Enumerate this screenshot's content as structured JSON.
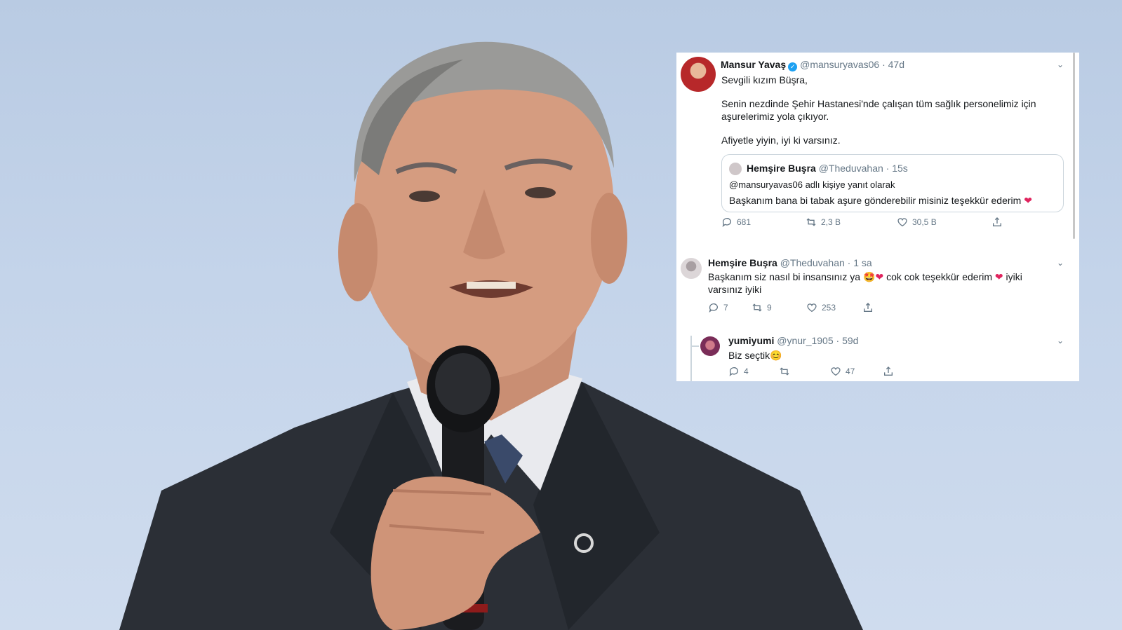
{
  "tweet_main": {
    "name": "Mansur Yavaş",
    "handle": "@mansuryavas06",
    "time": "· 47d",
    "line1": "Sevgili kızım Büşra,",
    "line2": "Senin nezdinde Şehir Hastanesi'nde çalışan tüm sağlık personelimiz için",
    "line3": "aşurelerimiz yola çıkıyor.",
    "line4": "Afiyetle yiyin, iyi ki varsınız.",
    "quote": {
      "name": "Hemşire Buşra",
      "handle": "@Theduvahan · 15s",
      "reply_to": "@mansuryavas06 adlı kişiye yanıt olarak",
      "text": "Başkanım bana bi tabak aşure gönderebilir misiniz teşekkür ederim"
    },
    "replies": "681",
    "retweets": "2,3 B",
    "likes": "30,5 B"
  },
  "tweet_reply1": {
    "name": "Hemşire Buşra",
    "handle": "@Theduvahan",
    "time": "· 1 sa",
    "text_a": "Başkanım siz nasıl bi insansınız ya",
    "text_b": "cok cok teşekkür ederim",
    "text_c": "iyiki",
    "text_d": "varsınız iyiki",
    "replies": "7",
    "retweets": "9",
    "likes": "253"
  },
  "tweet_reply2": {
    "name": "yumiyumi",
    "handle": "@ynur_1905",
    "time": "· 59d",
    "text": "Biz seçtik",
    "replies": "4",
    "retweets": "",
    "likes": "47"
  },
  "colors": {
    "sky": "#c4d4ea",
    "verified": "#1da1f2",
    "heart": "#e0245e",
    "muted": "#657786"
  }
}
